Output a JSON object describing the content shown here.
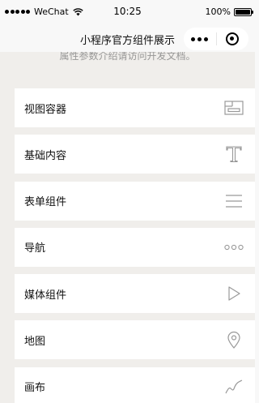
{
  "status_bar": {
    "carrier": "WeChat",
    "time": "10:25",
    "battery": "100%"
  },
  "nav": {
    "title": "小程序官方组件展示"
  },
  "intro": {
    "text": "属性参数介绍请访问开发文档。"
  },
  "menu": {
    "items": [
      {
        "label": "视图容器",
        "icon": "view-container-icon"
      },
      {
        "label": "基础内容",
        "icon": "text-t-icon"
      },
      {
        "label": "表单组件",
        "icon": "form-lines-icon"
      },
      {
        "label": "导航",
        "icon": "navigation-dots-icon"
      },
      {
        "label": "媒体组件",
        "icon": "play-triangle-icon"
      },
      {
        "label": "地图",
        "icon": "map-pin-icon"
      },
      {
        "label": "画布",
        "icon": "canvas-curve-icon"
      }
    ]
  },
  "colors": {
    "page_bg": "#f0eeeb",
    "bar_bg": "#f8f8f8",
    "icon_gray": "#999999"
  }
}
